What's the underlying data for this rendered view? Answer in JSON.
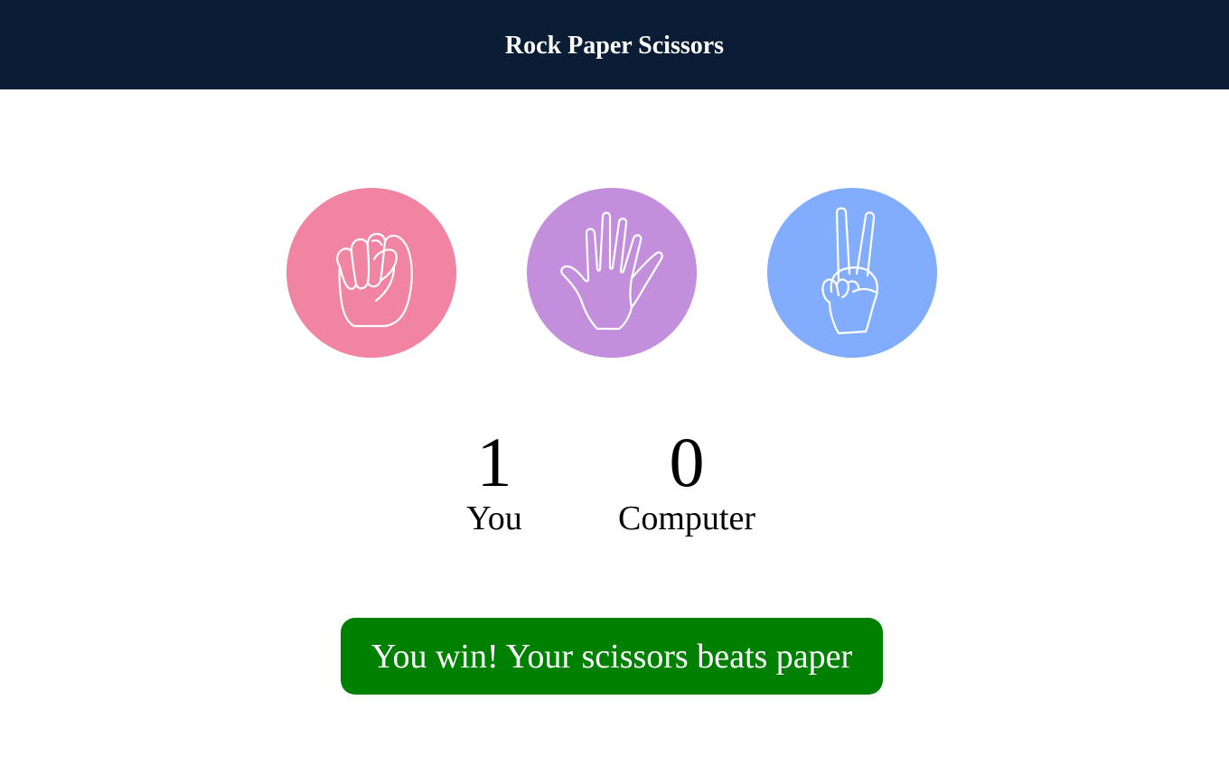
{
  "header": {
    "title": "Rock Paper Scissors"
  },
  "choices": [
    {
      "id": "rock",
      "icon": "fist-icon",
      "color": "#f084a2"
    },
    {
      "id": "paper",
      "icon": "open-hand-icon",
      "color": "#c38fdd"
    },
    {
      "id": "scissors",
      "icon": "peace-hand-icon",
      "color": "#82adff"
    }
  ],
  "scores": {
    "you": {
      "value": "1",
      "label": "You"
    },
    "computer": {
      "value": "0",
      "label": "Computer"
    }
  },
  "result": {
    "message": "You win! Your scissors beats paper",
    "color": "#008000"
  },
  "theme": {
    "header_bg": "#0b1d35",
    "text": "#000000"
  }
}
